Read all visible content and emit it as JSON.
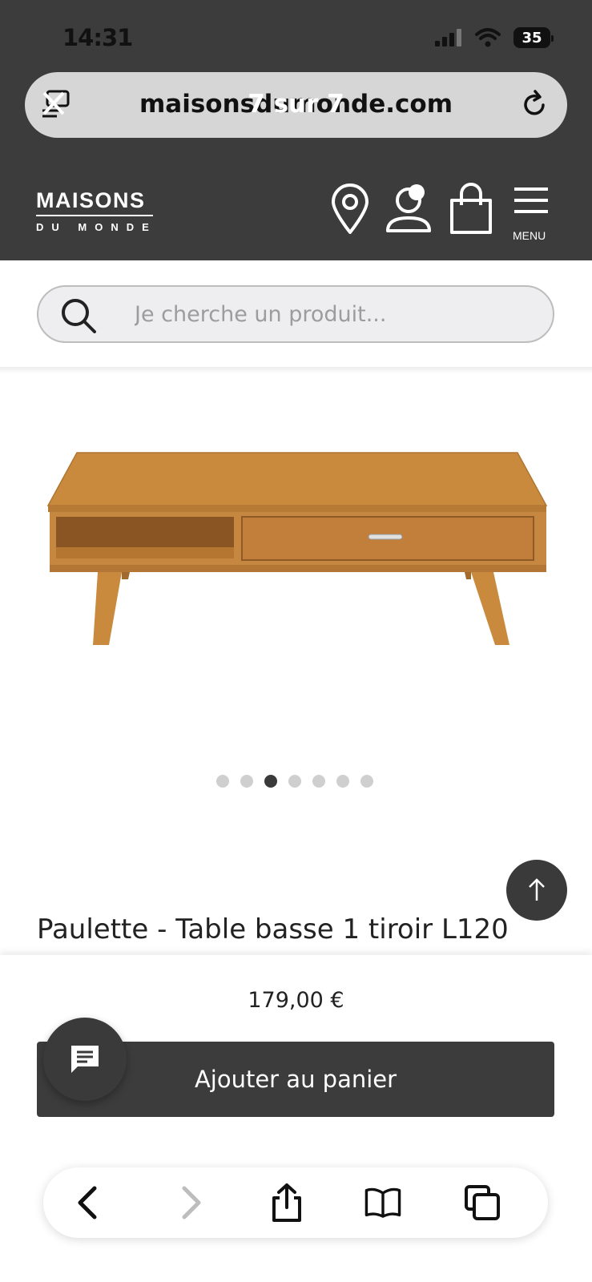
{
  "status_bar": {
    "time": "14:31",
    "battery": "35"
  },
  "url_bar": {
    "domain": "maisonsdumonde.com",
    "overlay_text": "7 sur 7"
  },
  "header": {
    "logo_main": "MAISONS",
    "logo_sub": "DU MONDE",
    "menu_label": "MENU"
  },
  "search": {
    "placeholder": "Je cherche un produit..."
  },
  "carousel": {
    "total": 7,
    "active_index": 2
  },
  "product": {
    "title": "Paulette - Table basse 1 tiroir L120",
    "price": "179,00 €",
    "add_to_cart_label": "Ajouter au panier"
  },
  "colors": {
    "header_bg": "#3c3c3c",
    "button_bg": "#3c3c3c",
    "wood": "#c98a3e"
  },
  "icons": [
    "close-icon",
    "refresh-icon",
    "location-icon",
    "account-icon",
    "cart-icon",
    "menu-icon",
    "search-icon",
    "scroll-top-icon",
    "chat-icon",
    "back-icon",
    "forward-icon",
    "share-icon",
    "bookmarks-icon",
    "tabs-icon"
  ]
}
